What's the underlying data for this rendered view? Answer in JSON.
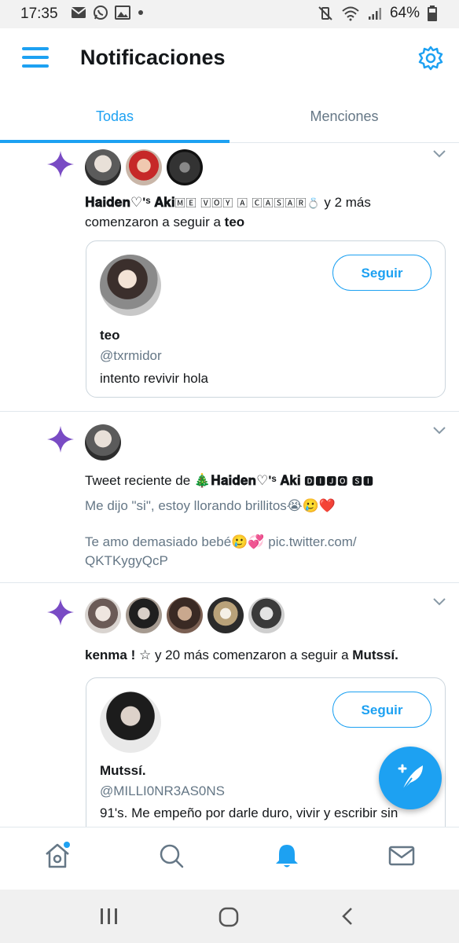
{
  "status_bar": {
    "time": "17:35",
    "battery": "64%",
    "left_icons": [
      "mail-icon",
      "whatsapp-icon",
      "image-icon",
      "dot-icon"
    ],
    "right_icons": [
      "mute-vibrate-icon",
      "wifi-icon",
      "signal-icon",
      "battery-icon"
    ]
  },
  "header": {
    "title": "Notificaciones"
  },
  "tabs": [
    {
      "label": "Todas",
      "active": true
    },
    {
      "label": "Menciones",
      "active": false
    }
  ],
  "notifications": [
    {
      "type": "follow",
      "actor_name": "𝐇𝐚𝐢𝐝𝐞𝐧♡'ˢ 𝐀𝐤𝐢",
      "actor_suffix": "🄼🄴 🅅🄾🅈 🄰 🄲🄰🅂🄰🅁💍",
      "text_middle": " y 2 más comenzaron a seguir a ",
      "target": "teo",
      "card": {
        "name": "teo",
        "handle": "@txrmidor",
        "bio": "intento revivir hola",
        "follow_label": "Seguir"
      }
    },
    {
      "type": "recent_tweet",
      "prefix": "Tweet reciente de ",
      "actor_name": "🎄𝐇𝐚𝐢𝐝𝐞𝐧♡'ˢ 𝐀𝐤𝐢",
      "actor_suffix": " 🅳🅸🅹🅾 🆂🅸",
      "tweet_line1": "Me dijo \"si\", estoy llorando brillitos😭🥲❤️",
      "tweet_line2": "Te amo demasiado bebé🥲💞 pic.twitter.com/",
      "tweet_line3": "QKTKygyQcP"
    },
    {
      "type": "follow",
      "actor_name": "kenma ! ☆",
      "text_middle": " y 20 más comenzaron a seguir a ",
      "target": "Mutssí.",
      "card": {
        "name": "Mutssí.",
        "handle": "@MILLI0NR3AS0NS",
        "bio": "91's. Me empeño por darle duro, vivir y escribir sin",
        "follow_label": "Seguir"
      }
    }
  ],
  "bottom_nav": [
    "home-icon",
    "search-icon",
    "notifications-bell-icon",
    "messages-icon"
  ],
  "system_nav": [
    "recents-icon",
    "home-circle-icon",
    "back-icon"
  ],
  "colors": {
    "accent": "#1da1f2",
    "sparkle": "#794bc4",
    "text": "#14171a",
    "secondary": "#657786"
  }
}
